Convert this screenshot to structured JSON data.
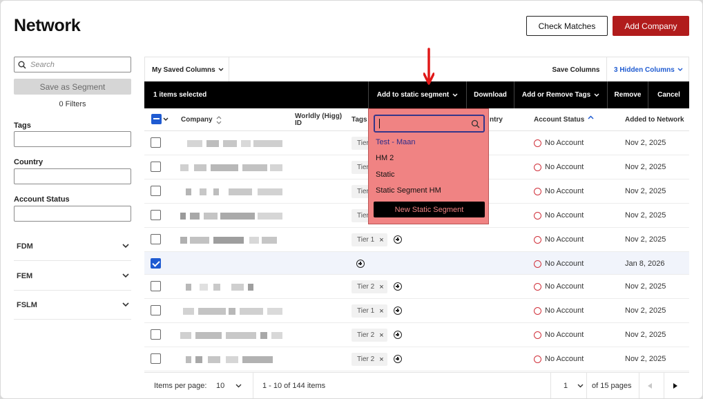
{
  "header": {
    "title": "Network",
    "check_matches": "Check Matches",
    "add_company": "Add Company"
  },
  "sidebar": {
    "search_placeholder": "Search",
    "save_segment": "Save as Segment",
    "filters_count": "0 Filters",
    "filters": [
      {
        "label": "Tags"
      },
      {
        "label": "Country"
      },
      {
        "label": "Account Status"
      }
    ],
    "accordions": [
      {
        "label": "FDM"
      },
      {
        "label": "FEM"
      },
      {
        "label": "FSLM"
      }
    ]
  },
  "toolbar": {
    "saved_columns": "My Saved Columns",
    "save_columns": "Save Columns",
    "hidden_columns": "3 Hidden Columns"
  },
  "action_bar": {
    "selected": "1 items selected",
    "add_static": "Add to static segment",
    "download": "Download",
    "add_remove_tags": "Add or Remove Tags",
    "remove": "Remove",
    "cancel": "Cancel"
  },
  "columns": {
    "company": "Company",
    "worldly": "Worldly (Higg) ID",
    "tags": "Tags",
    "country": "ntry",
    "account_status": "Account Status",
    "added": "Added to Network"
  },
  "rows": [
    {
      "tag": "Tier",
      "status": "No Account",
      "added": "Nov 2, 2025",
      "checked": false
    },
    {
      "tag": "Tier",
      "status": "No Account",
      "added": "Nov 2, 2025",
      "checked": false
    },
    {
      "tag": "Tier",
      "status": "No Account",
      "added": "Nov 2, 2025",
      "checked": false
    },
    {
      "tag": "Tier",
      "status": "No Account",
      "added": "Nov 2, 2025",
      "checked": false
    },
    {
      "tag": "Tier 1",
      "status": "No Account",
      "added": "Nov 2, 2025",
      "checked": false
    },
    {
      "tag": "",
      "status": "No Account",
      "added": "Jan 8, 2026",
      "checked": true
    },
    {
      "tag": "Tier 2",
      "status": "No Account",
      "added": "Nov 2, 2025",
      "checked": false
    },
    {
      "tag": "Tier 1",
      "status": "No Account",
      "added": "Nov 2, 2025",
      "checked": false
    },
    {
      "tag": "Tier 2",
      "status": "No Account",
      "added": "Nov 2, 2025",
      "checked": false
    },
    {
      "tag": "Tier 2",
      "status": "No Account",
      "added": "Nov 2, 2025",
      "checked": false
    }
  ],
  "dropdown": {
    "items": [
      "Test - Maan",
      "HM 2",
      "Static",
      "Static Segment HM"
    ],
    "new_button": "New Static Segment"
  },
  "pagination": {
    "items_per_page_label": "Items per page:",
    "items_per_page": "10",
    "range": "1 - 10 of 144 items",
    "page": "1",
    "of_pages": "of 15 pages"
  },
  "colors": {
    "brand_red": "#b11c1c",
    "selection_blue": "#1f5bd1",
    "dropdown_bg": "#f08383",
    "status_red": "#d0303a"
  }
}
